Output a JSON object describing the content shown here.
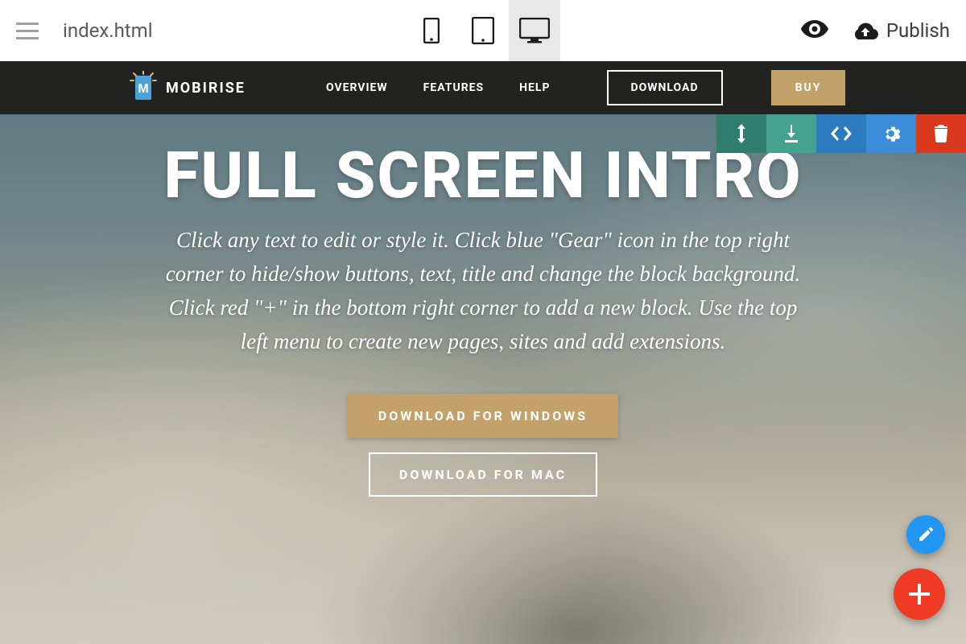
{
  "appbar": {
    "filename": "index.html",
    "publish_label": "Publish"
  },
  "site_nav": {
    "brand": "MOBIRISE",
    "links": [
      "OVERVIEW",
      "FEATURES",
      "HELP"
    ],
    "download_label": "DOWNLOAD",
    "buy_label": "BUY"
  },
  "hero": {
    "title": "FULL SCREEN INTRO",
    "subtitle": "Click any text to edit or style it. Click blue \"Gear\" icon in the top right corner to hide/show buttons, text, title and change the block background.\nClick red \"+\" in the bottom right corner to add a new block. Use the top left menu to create new pages, sites and add extensions.",
    "cta_primary": "DOWNLOAD FOR WINDOWS",
    "cta_secondary": "DOWNLOAD FOR MAC"
  },
  "colors": {
    "accent_tan": "#c4a06a",
    "fab_blue": "#2196f3",
    "fab_red": "#ef3b24"
  }
}
